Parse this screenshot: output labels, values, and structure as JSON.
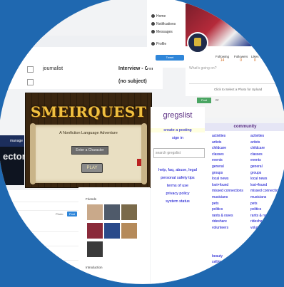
{
  "mail": {
    "rows": [
      {
        "from": "journalist",
        "subject": "Interview - OTI"
      },
      {
        "from": "",
        "subject": "(no subject)"
      }
    ]
  },
  "social": {
    "nav": [
      "Home",
      "Notifications",
      "Messages",
      "Profile"
    ],
    "button": "Tweet"
  },
  "profile": {
    "stats": [
      {
        "label": "Following",
        "value": "14"
      },
      {
        "label": "Followers",
        "value": "0"
      },
      {
        "label": "Likes",
        "value": "0"
      }
    ],
    "compose_placeholder": "What's going on?",
    "attach_text": "Click to Select a Photo for Upload",
    "tab_post": "Post",
    "tab_second": "Cr"
  },
  "game": {
    "title": "SMEIRQUEST",
    "subtitle": "A Nonfiction Language Adventure",
    "name_placeholder": "Enter a Character",
    "play_label": "PLAY"
  },
  "dark": {
    "strip": "manage",
    "text": "ector"
  },
  "gregslist": {
    "logo": "gregslist",
    "links_top": [
      "create a posting",
      "sign in"
    ],
    "search_placeholder": "search gregslist",
    "links_help": [
      "help, faq, abuse, legal",
      "personal safety tips",
      "terms of use",
      "privacy policy",
      "system status"
    ]
  },
  "community": {
    "heading": "community",
    "col1": [
      "activities",
      "artists",
      "childcare",
      "classes",
      "events",
      "general",
      "groups",
      "local news",
      "lost+found",
      "missed connections",
      "musicians",
      "pets",
      "politics",
      "rants & raves",
      "rideshare",
      "volunteers"
    ],
    "col2": [
      "activities",
      "artists",
      "childcare",
      "classes",
      "events",
      "general",
      "groups",
      "local news",
      "lost+found",
      "missed connections",
      "musicians",
      "pets",
      "politics",
      "rants & raves",
      "rideshare",
      "volunteers"
    ],
    "bottom": [
      "beauty",
      "cell/mobile"
    ]
  },
  "photos": {
    "label": "Friends",
    "label2": "Introduction"
  },
  "feed": {
    "tag": "Photo",
    "button": "Post"
  }
}
